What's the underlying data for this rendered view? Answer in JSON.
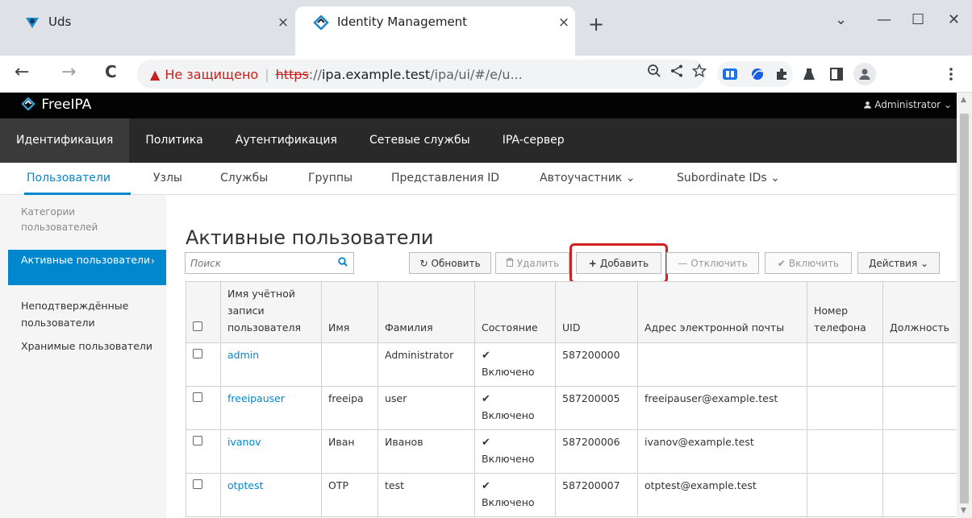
{
  "browser": {
    "tabs": [
      {
        "title": "Uds",
        "close": "×"
      },
      {
        "title": "Identity Management",
        "close": "×"
      }
    ],
    "new_tab": "+",
    "window_controls": {
      "tabsearch": "⌄",
      "minimize": "—",
      "maximize": "☐",
      "close": "✕"
    },
    "nav": {
      "back": "←",
      "forward": "→",
      "reload": "C"
    },
    "url": {
      "warning_icon": "▲",
      "security_label": "Не защищено",
      "separator": "|",
      "scheme": "https",
      "scheme_sep": "://",
      "host": "ipa.example.test",
      "path": "/ipa/ui/#/e/u..."
    },
    "icons": [
      "zoom-icon",
      "share-icon",
      "star-icon",
      "extension-icons",
      "profile-icon",
      "menu-icon"
    ]
  },
  "app": {
    "brand": "FreeIPA",
    "user_menu": "Administrator",
    "main_nav": [
      "Идентификация",
      "Политика",
      "Аутентификация",
      "Сетевые службы",
      "IPA-сервер"
    ],
    "sub_nav": [
      "Пользователи",
      "Узлы",
      "Службы",
      "Группы",
      "Представления ID",
      "Автоучастник",
      "Subordinate IDs"
    ],
    "sidebar": {
      "category": "Категории пользователей",
      "items": [
        "Активные пользователи",
        "Неподтверждённые пользователи",
        "Хранимые пользователи"
      ]
    },
    "page_title": "Активные пользователи",
    "search_placeholder": "Поиск",
    "buttons": {
      "refresh": "Обновить",
      "delete": "Удалить",
      "add": "Добавить",
      "disable": "Отключить",
      "enable": "Включить",
      "actions": "Действия"
    },
    "columns": [
      "Имя учётной записи пользователя",
      "Имя",
      "Фамилия",
      "Состояние",
      "UID",
      "Адрес электронной почты",
      "Номер телефона",
      "Должность"
    ],
    "status_label": "Включено",
    "status_mark": "✔",
    "rows": [
      {
        "login": "admin",
        "first": "",
        "last": "Administrator",
        "uid": "587200000",
        "email": "",
        "phone": "",
        "title": ""
      },
      {
        "login": "freeipauser",
        "first": "freeipa",
        "last": "user",
        "uid": "587200005",
        "email": "freeipauser@example.test",
        "phone": "",
        "title": ""
      },
      {
        "login": "ivanov",
        "first": "Иван",
        "last": "Иванов",
        "uid": "587200006",
        "email": "ivanov@example.test",
        "phone": "",
        "title": ""
      },
      {
        "login": "otptest",
        "first": "OTP",
        "last": "test",
        "uid": "587200007",
        "email": "otptest@example.test",
        "phone": "",
        "title": ""
      }
    ]
  },
  "colors": {
    "accent": "#0088ce",
    "highlight": "#d02020",
    "nav_bg": "#292929",
    "topbar_bg": "#030303"
  }
}
